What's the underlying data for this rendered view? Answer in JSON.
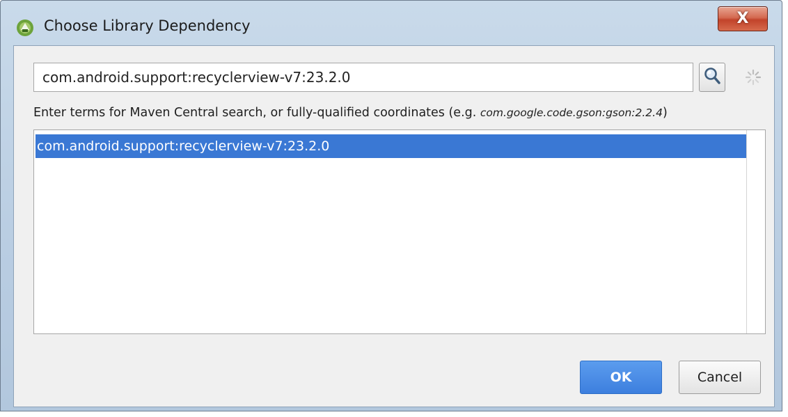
{
  "window": {
    "title": "Choose Library Dependency",
    "close_label": "X"
  },
  "search": {
    "value": "com.android.support:recyclerview-v7:23.2.0",
    "search_icon": "magnifier-icon",
    "spinner_icon": "loading-spinner-icon"
  },
  "hint": {
    "text": "Enter terms for Maven Central search, or fully-qualified coordinates (e.g. ",
    "example": "com.google.code.gson:gson:2.2.4",
    "suffix": ")"
  },
  "results": {
    "items": [
      {
        "label": "com.android.support:recyclerview-v7:23.2.0",
        "selected": true
      }
    ]
  },
  "buttons": {
    "ok_label": "OK",
    "cancel_label": "Cancel"
  },
  "colors": {
    "selection": "#3a78d4",
    "ok_button": "#3d7fde",
    "close_button": "#c2432a"
  }
}
